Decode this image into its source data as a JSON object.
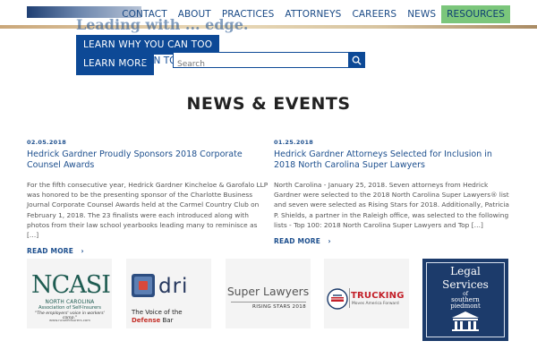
{
  "header": {
    "nav": [
      {
        "label": "CONTACT"
      },
      {
        "label": "ABOUT"
      },
      {
        "label": "PRACTICES"
      },
      {
        "label": "ATTORNEYS"
      },
      {
        "label": "CAREERS"
      },
      {
        "label": "NEWS"
      },
      {
        "label": "RESOURCES",
        "active": true
      }
    ]
  },
  "hero": {
    "ghost_text": "Leading with ... edge.",
    "learn_why_label": "LEARN WHY YOU CAN TOO",
    "learn_more_label": "LEARN MORE",
    "peek_text": "CAN TOO",
    "search_placeholder": "Search"
  },
  "section": {
    "title": "NEWS & EVENTS"
  },
  "news": [
    {
      "date": "02.05.2018",
      "title": "Hedrick Gardner Proudly Sponsors 2018 Corporate Counsel Awards",
      "body": "For the fifth consecutive year, Hedrick Gardner Kincheloe & Garofalo LLP was honored to be the presenting sponsor of the Charlotte Business Journal Corporate Counsel Awards held at the Carmel Country Club on February 1, 2018. The 23 finalists were each introduced along with photos from their law school yearbooks leading many to reminisce as […]",
      "read_more": "READ MORE"
    },
    {
      "date": "01.25.2018",
      "title": "Hedrick Gardner Attorneys Selected for Inclusion in 2018 North Carolina Super Lawyers",
      "body": "North Carolina - January 25, 2018. Seven attorneys from Hedrick Gardner were selected to the 2018 North Carolina Super Lawyers® list and seven were selected as Rising Stars for 2018. Additionally, Patricia P. Shields, a partner in the Raleigh office, was selected to the following lists - Top 100: 2018 North Carolina Super Lawyers and Top […]",
      "read_more": "READ MORE"
    }
  ],
  "logos": {
    "ncasi": {
      "main": "NCASI",
      "sub1": "NORTH CAROLINA",
      "sub2": "Association of Self-Insurers",
      "tagline": "\"The employers' voice in workers' comp.\"",
      "url": "www.ncselfinsurers.com"
    },
    "dri": {
      "main": "dri",
      "tag1": "The Voice of the",
      "tag2": "Defense",
      "tag3": "Bar"
    },
    "superlawyers": {
      "main": "Super Lawyers",
      "sub": "RISING STARS 2018"
    },
    "trucking": {
      "main": "TRUCKING",
      "sub": "Moves America Forward"
    },
    "legal": {
      "l1": "Legal",
      "l2": "Services",
      "l3": "of",
      "l4": "southern",
      "l5": "piedmont"
    }
  },
  "colors": {
    "brand_blue": "#0d4996",
    "link_blue": "#1d4f8e",
    "nav_active": "#7bc67b",
    "legal_navy": "#1c3b6b"
  }
}
